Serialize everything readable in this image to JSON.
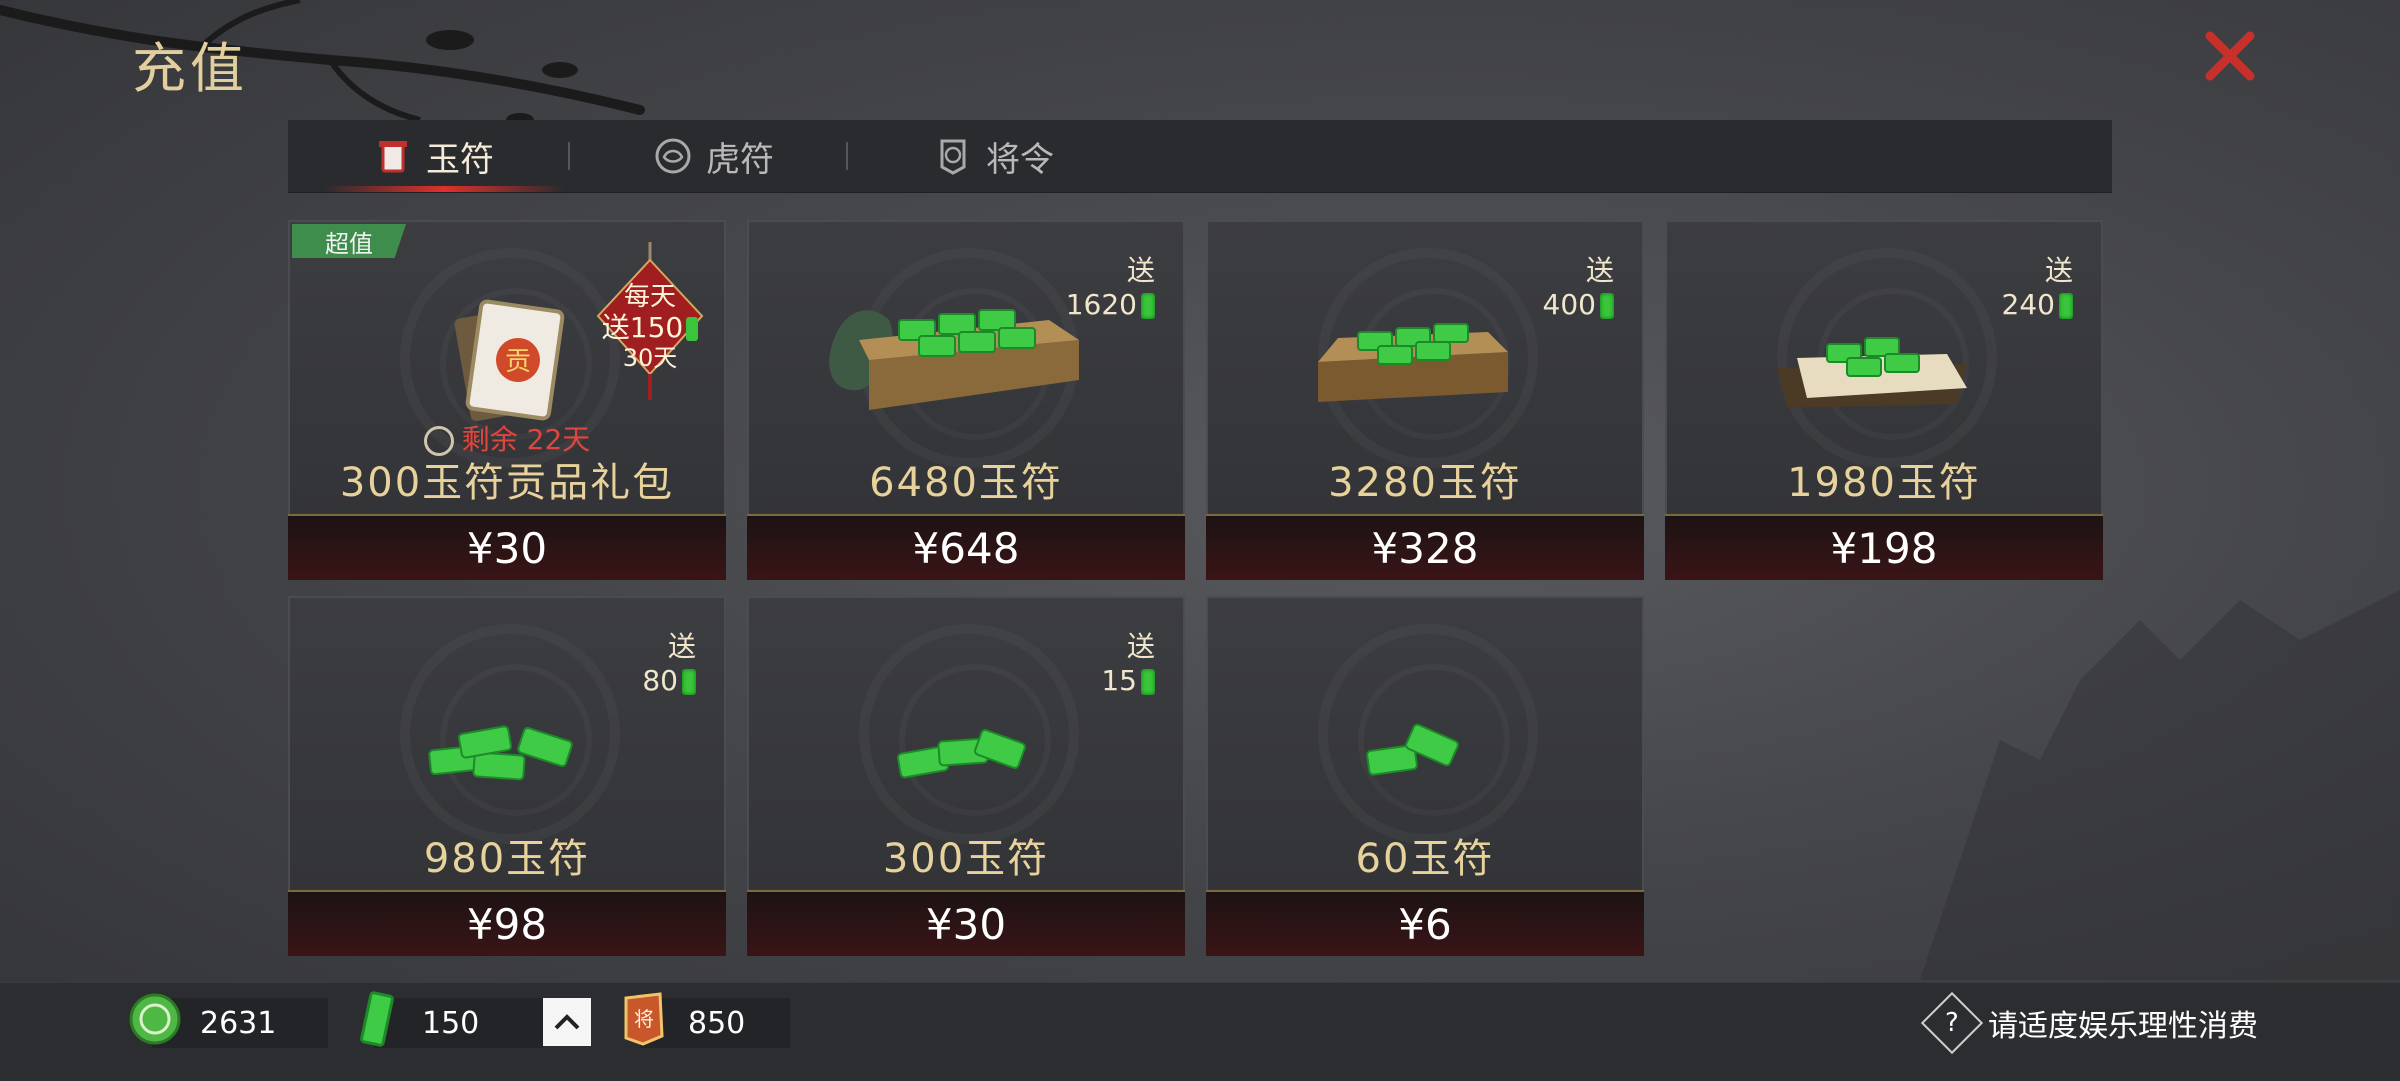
{
  "title": "充值",
  "tabs": [
    {
      "label": "玉符",
      "icon": "jade-token-icon",
      "active": true
    },
    {
      "label": "虎符",
      "icon": "tiger-token-icon",
      "active": false
    },
    {
      "label": "将令",
      "icon": "general-order-icon",
      "active": false
    }
  ],
  "cards": [
    {
      "name": "300玉符贡品礼包",
      "price": "¥30",
      "badge": "超值",
      "daily": {
        "line1": "每天",
        "line2": "送150",
        "line3": "30天"
      },
      "timer": "剩余 22天",
      "icon": "tribute-gift-pack-icon"
    },
    {
      "name": "6480玉符",
      "price": "¥648",
      "bonus_label": "送",
      "bonus_value": "1620",
      "icon": "jade-tray-large-icon"
    },
    {
      "name": "3280玉符",
      "price": "¥328",
      "bonus_label": "送",
      "bonus_value": "400",
      "icon": "jade-tray-medium-icon"
    },
    {
      "name": "1980玉符",
      "price": "¥198",
      "bonus_label": "送",
      "bonus_value": "240",
      "icon": "jade-tray-small-icon"
    },
    {
      "name": "980玉符",
      "price": "¥98",
      "bonus_label": "送",
      "bonus_value": "80",
      "icon": "jade-pile-icon"
    },
    {
      "name": "300玉符",
      "price": "¥30",
      "bonus_label": "送",
      "bonus_value": "15",
      "icon": "jade-pile-small-icon"
    },
    {
      "name": "60玉符",
      "price": "¥6",
      "icon": "jade-few-icon"
    }
  ],
  "currencies": [
    {
      "value": "2631",
      "icon": "green-coin-icon"
    },
    {
      "value": "150",
      "icon": "jade-token-currency-icon"
    },
    {
      "value": "850",
      "icon": "general-order-currency-icon"
    }
  ],
  "notice": "请适度娱乐理性消费",
  "colors": {
    "accent_red": "#e0302a",
    "gold_text": "#e7d29c",
    "jade_green": "#39c63a"
  }
}
